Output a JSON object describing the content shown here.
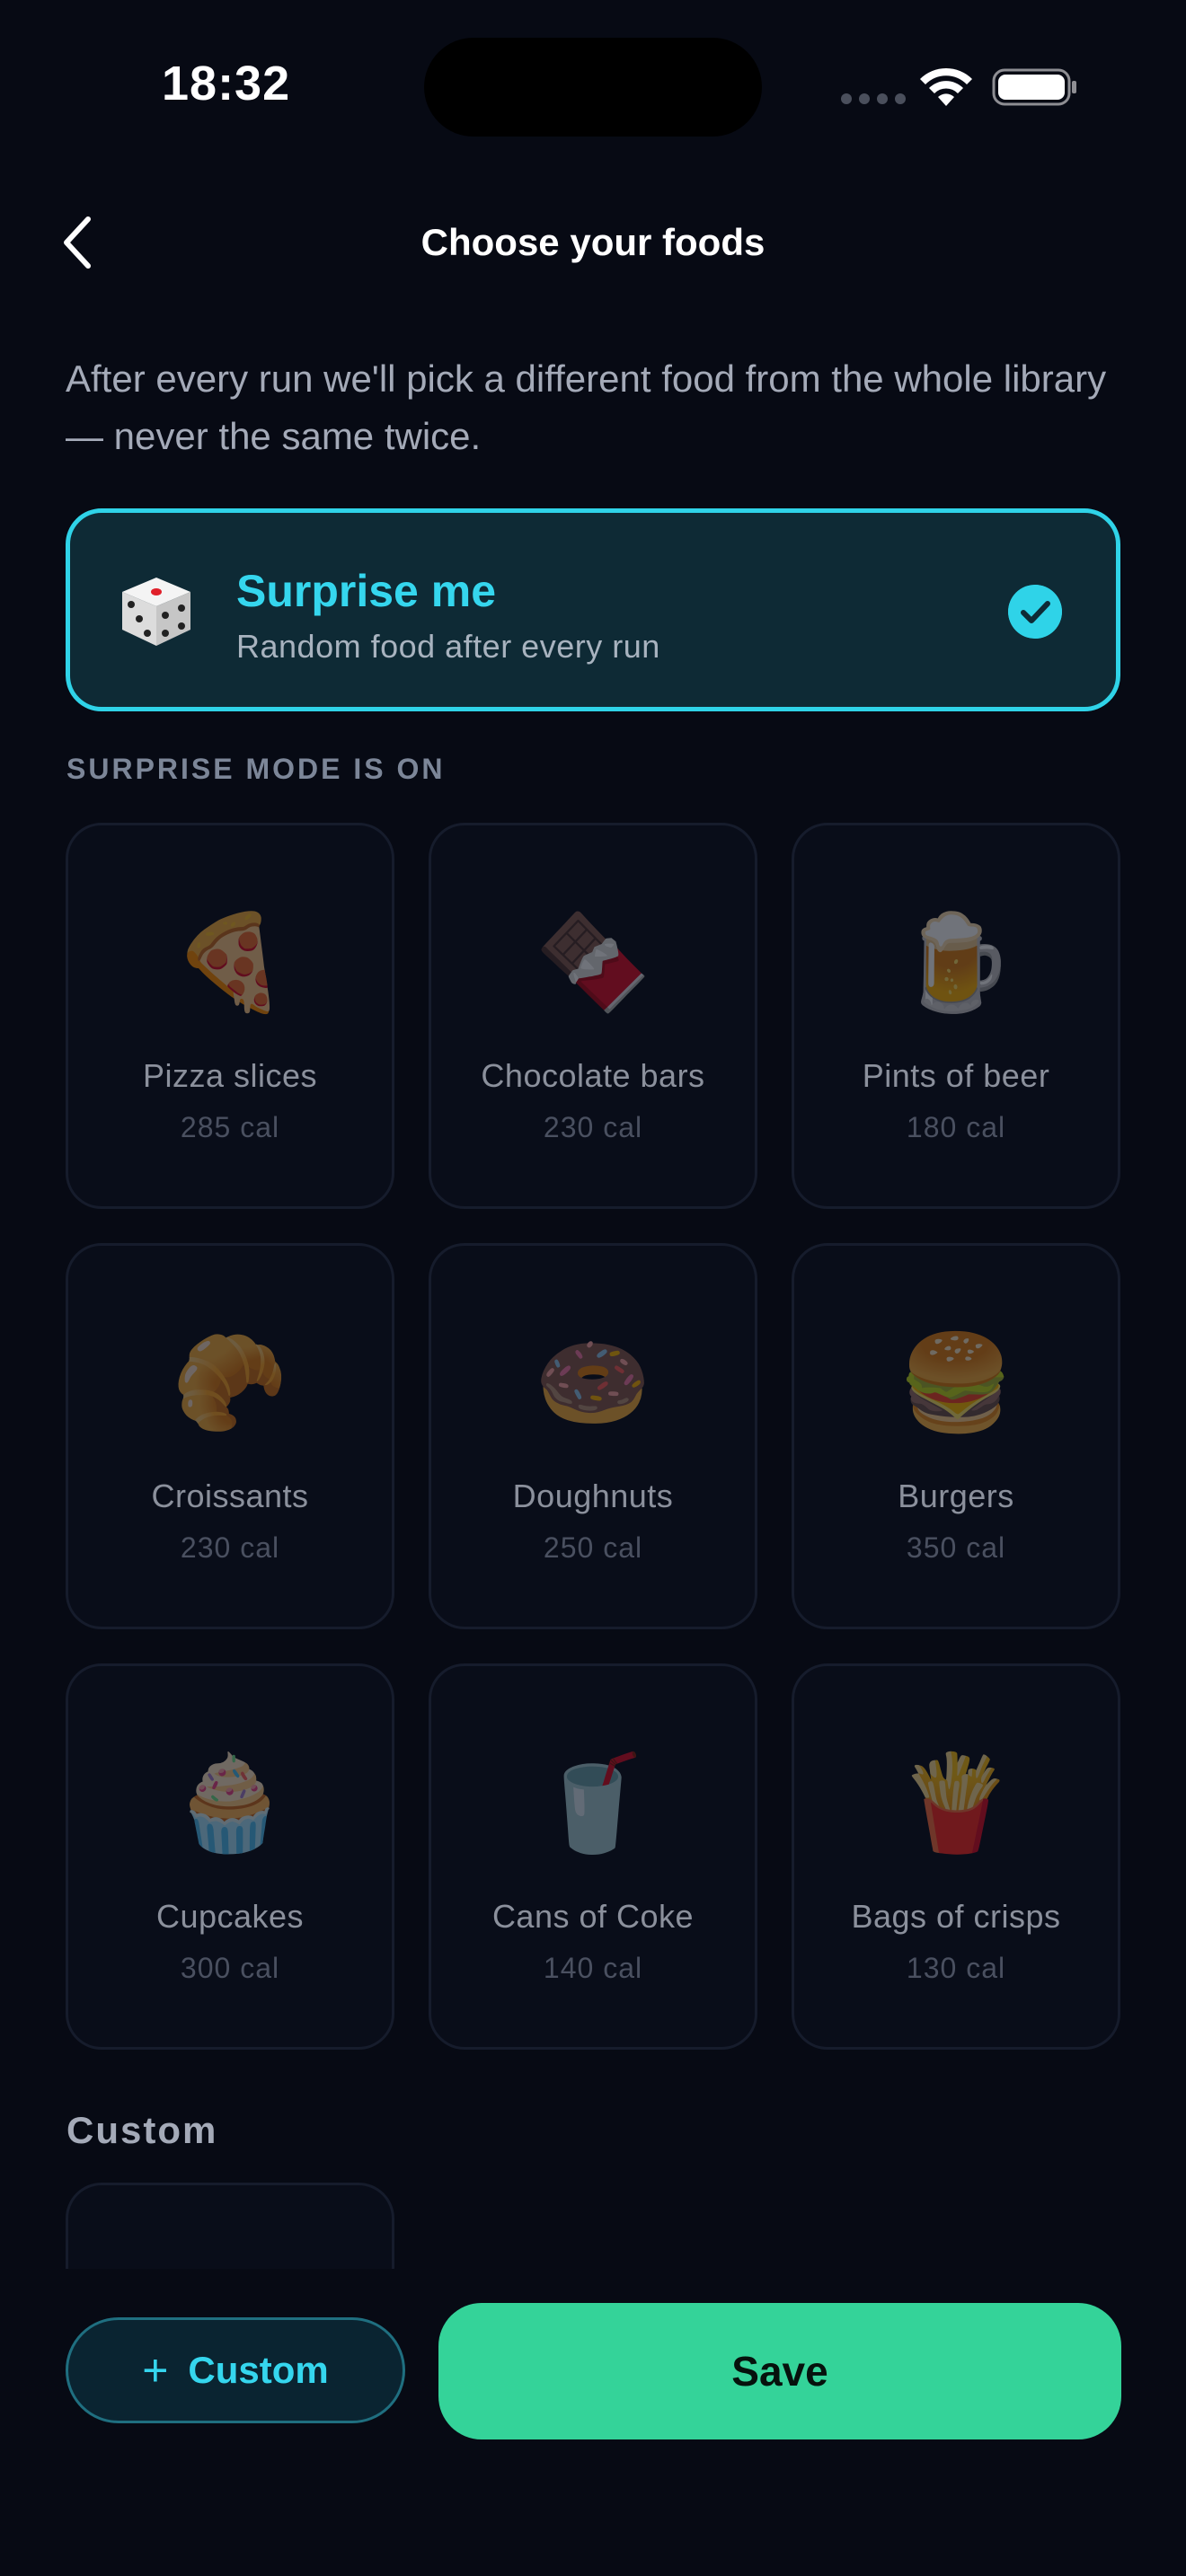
{
  "status_bar": {
    "time": "18:32"
  },
  "header": {
    "title": "Choose your foods",
    "back_icon": "chevron-left-icon"
  },
  "intro": "After every run we'll pick a different food from the whole library — never the same twice.",
  "surprise": {
    "title": "Surprise me",
    "subtitle": "Random food after every run",
    "selected": true,
    "icon": "dice-icon"
  },
  "section_label": "SURPRISE MODE IS ON",
  "foods": [
    {
      "emoji": "🍕",
      "icon": "pizza-icon",
      "name": "Pizza slices",
      "cal": "285 cal"
    },
    {
      "emoji": "🍫",
      "icon": "chocolate-icon",
      "name": "Chocolate bars",
      "cal": "230 cal"
    },
    {
      "emoji": "🍺",
      "icon": "beer-icon",
      "name": "Pints of beer",
      "cal": "180 cal"
    },
    {
      "emoji": "🥐",
      "icon": "croissant-icon",
      "name": "Croissants",
      "cal": "230 cal"
    },
    {
      "emoji": "🍩",
      "icon": "doughnut-icon",
      "name": "Doughnuts",
      "cal": "250 cal"
    },
    {
      "emoji": "🍔",
      "icon": "burger-icon",
      "name": "Burgers",
      "cal": "350 cal"
    },
    {
      "emoji": "🧁",
      "icon": "cupcake-icon",
      "name": "Cupcakes",
      "cal": "300 cal"
    },
    {
      "emoji": "🥤",
      "icon": "soda-cup-icon",
      "name": "Cans of Coke",
      "cal": "140 cal"
    },
    {
      "emoji": "🍟",
      "icon": "fries-icon",
      "name": "Bags of crisps",
      "cal": "130 cal"
    }
  ],
  "custom_section": {
    "label": "Custom"
  },
  "actions": {
    "custom_label": "Custom",
    "plus": "+",
    "save_label": "Save"
  },
  "colors": {
    "background": "#070a14",
    "accent_cyan": "#2fd3e8",
    "save_green": "#34d399"
  }
}
